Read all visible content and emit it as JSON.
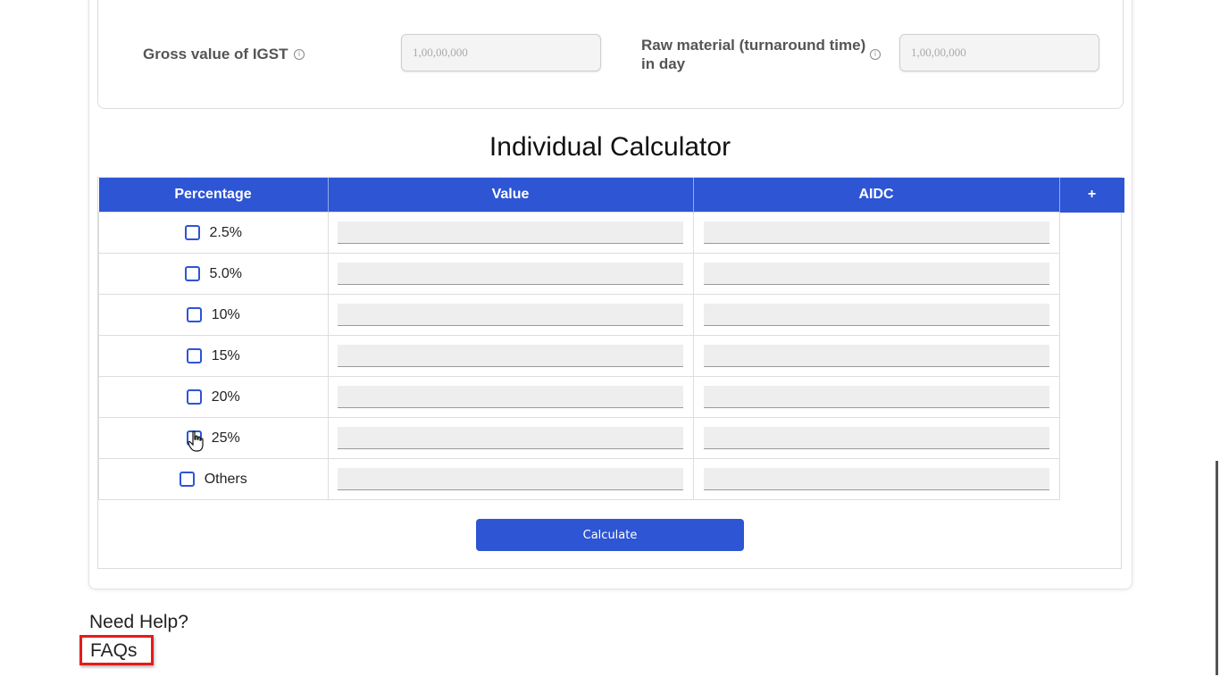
{
  "top_fields": {
    "gross_igst": {
      "label": "Gross value of IGST",
      "placeholder": "1,00,00,000",
      "info_icon": "info-icon"
    },
    "raw_material": {
      "label_line1": "Raw material (turnaround time)",
      "label_line2": "in day",
      "placeholder": "1,00,00,000",
      "info_icon": "info-icon"
    }
  },
  "section_title": "Individual Calculator",
  "table": {
    "headers": [
      "Percentage",
      "Value",
      "AIDC",
      "+"
    ],
    "rows": [
      {
        "label": "2.5%"
      },
      {
        "label": "5.0%"
      },
      {
        "label": "10%"
      },
      {
        "label": "15%"
      },
      {
        "label": "20%"
      },
      {
        "label": "25%"
      },
      {
        "label": "Others"
      }
    ]
  },
  "calculate_label": "Calculate",
  "help": {
    "title": "Need Help?",
    "faq_label": "FAQs"
  },
  "colors": {
    "accent": "#2d55d4",
    "highlight": "#e41b1b"
  }
}
